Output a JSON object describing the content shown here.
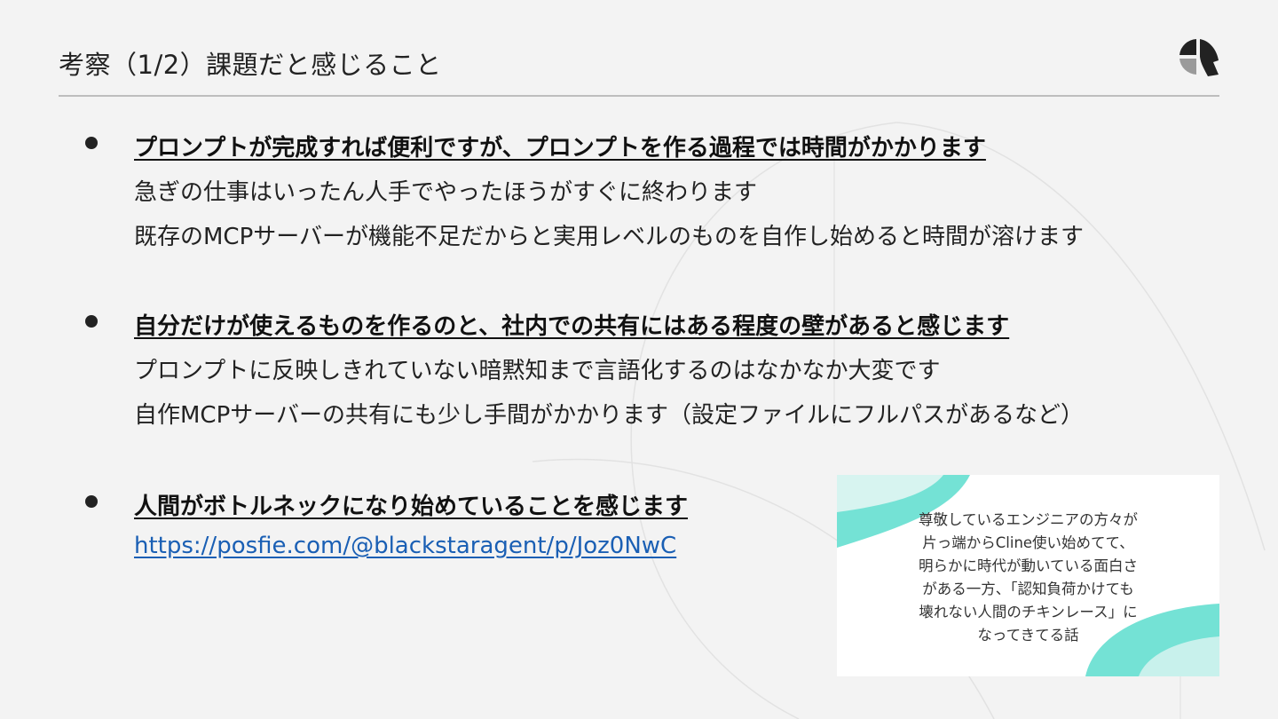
{
  "slide": {
    "title": "考察（1/2）課題だと感じること"
  },
  "colors": {
    "accent": "#7ee0d6",
    "link": "#1a5fb4",
    "text": "#222222",
    "background": "#f3f3f3"
  },
  "bullets": [
    {
      "heading": "プロンプトが完成すれば便利ですが、プロンプトを作る過程では時間がかかります",
      "lines": [
        "急ぎの仕事はいったん人手でやったほうがすぐに終わります",
        "既存のMCPサーバーが機能不足だからと実用レベルのものを自作し始めると時間が溶けます"
      ]
    },
    {
      "heading": "自分だけが使えるものを作るのと、社内での共有にはある程度の壁があると感じます",
      "lines": [
        "プロンプトに反映しきれていない暗黙知まで言語化するのはなかなか大変です",
        "自作MCPサーバーの共有にも少し手間がかかります（設定ファイルにフルパスがあるなど）"
      ]
    },
    {
      "heading": "人間がボトルネックになり始めていることを感じます",
      "link": "https://posfie.com/@blackstaragent/p/Joz0NwC"
    }
  ],
  "card": {
    "lines": [
      "尊敬しているエンジニアの方々が",
      "片っ端からCline使い始めてて、",
      "明らかに時代が動いている面白さ",
      "がある一方、「認知負荷かけても",
      "壊れない人間のチキンレース」に",
      "なってきてる話"
    ]
  }
}
